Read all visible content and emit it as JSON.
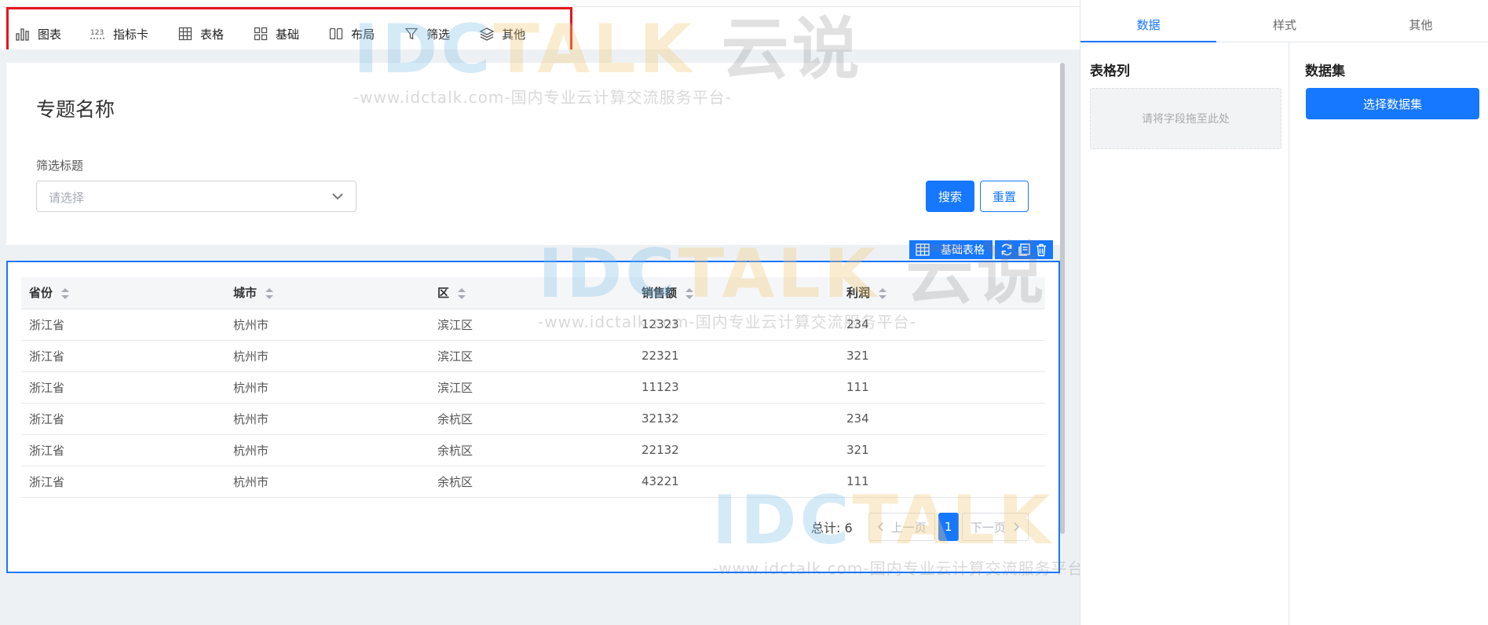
{
  "toolbar": {
    "items": [
      {
        "label": "图表",
        "icon": "bar-chart-icon"
      },
      {
        "label": "指标卡",
        "icon": "number-card-icon"
      },
      {
        "label": "表格",
        "icon": "table-icon"
      },
      {
        "label": "基础",
        "icon": "grid-blocks-icon"
      },
      {
        "label": "布局",
        "icon": "layout-columns-icon"
      },
      {
        "label": "筛选",
        "icon": "filter-icon"
      },
      {
        "label": "其他",
        "icon": "layers-icon"
      }
    ]
  },
  "filter_panel": {
    "topic_title": "专题名称",
    "filter_label": "筛选标题",
    "select_placeholder": "请选择",
    "search_label": "搜索",
    "reset_label": "重置"
  },
  "component": {
    "name": "基础表格",
    "actions": [
      "refresh-icon",
      "copy-icon",
      "delete-icon"
    ]
  },
  "table": {
    "headers": [
      "省份",
      "城市",
      "区",
      "销售额",
      "利润"
    ],
    "rows": [
      [
        "浙江省",
        "杭州市",
        "滨江区",
        "12323",
        "234"
      ],
      [
        "浙江省",
        "杭州市",
        "滨江区",
        "22321",
        "321"
      ],
      [
        "浙江省",
        "杭州市",
        "滨江区",
        "11123",
        "111"
      ],
      [
        "浙江省",
        "杭州市",
        "余杭区",
        "32132",
        "234"
      ],
      [
        "浙江省",
        "杭州市",
        "余杭区",
        "22132",
        "321"
      ],
      [
        "浙江省",
        "杭州市",
        "余杭区",
        "43221",
        "111"
      ]
    ]
  },
  "pagination": {
    "total_text": "总计: 6",
    "prev_label": "上一页",
    "current_page": "1",
    "next_label": "下一页"
  },
  "watermark": {
    "logo_a": "IDC",
    "logo_b": "TALK",
    "logo_c": "云说",
    "sub": "-www.idctalk.com-国内专业云计算交流服务平台-"
  },
  "side": {
    "tabs": [
      "数据",
      "样式",
      "其他"
    ],
    "active_tab": "数据",
    "table_columns_heading": "表格列",
    "drop_zone_text": "请将字段拖至此处",
    "dataset_heading": "数据集",
    "choose_dataset_label": "选择数据集"
  },
  "colors": {
    "accent": "#1677ff",
    "highlight_border": "#e8141c",
    "canvas_bg": "#eef1f4"
  }
}
